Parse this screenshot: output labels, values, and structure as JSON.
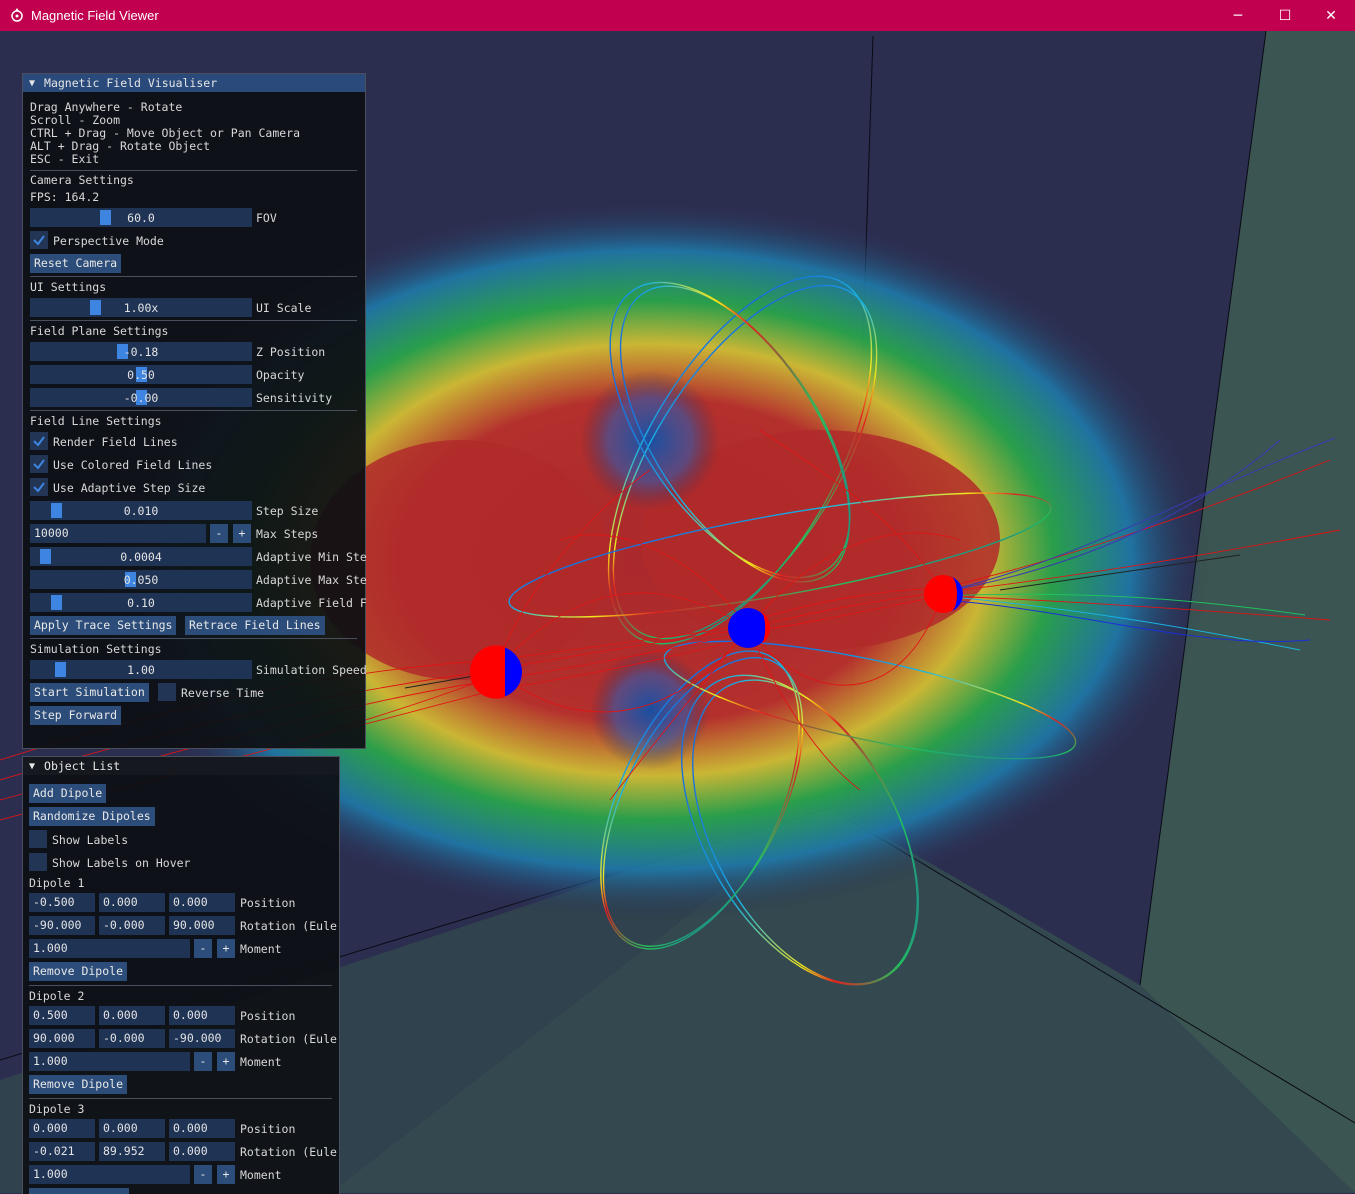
{
  "window": {
    "title": "Magnetic Field Viewer",
    "minimize": "─",
    "maximize": "☐",
    "close": "✕"
  },
  "visualiser": {
    "title": "Magnetic Field Visualiser",
    "help": [
      "Drag Anywhere - Rotate",
      "Scroll - Zoom",
      "CTRL + Drag - Move Object or Pan Camera",
      "ALT + Drag - Rotate Object",
      "ESC - Exit"
    ],
    "camera": {
      "heading": "Camera Settings",
      "fps": "FPS: 164.2",
      "fov_value": "60.0",
      "fov_label": "FOV",
      "fov_fraction": 0.33,
      "perspective_label": "Perspective Mode",
      "perspective_checked": true,
      "reset_label": "Reset Camera"
    },
    "ui": {
      "heading": "UI Settings",
      "scale_value": "1.00x",
      "scale_label": "UI Scale",
      "scale_fraction": 0.28
    },
    "plane": {
      "heading": "Field Plane Settings",
      "z_value": "-0.18",
      "z_label": "Z Position",
      "z_fraction": 0.41,
      "opacity_value": "0.50",
      "opacity_label": "Opacity",
      "opacity_fraction": 0.5,
      "sens_value": "-0.00",
      "sens_label": "Sensitivity",
      "sens_fraction": 0.5
    },
    "lines": {
      "heading": "Field Line Settings",
      "render_label": "Render Field Lines",
      "colored_label": "Use Colored Field Lines",
      "adaptive_label": "Use Adaptive Step Size",
      "step_value": "0.010",
      "step_label": "Step Size",
      "step_fraction": 0.09,
      "max_steps_value": "10000",
      "max_steps_label": "Max Steps",
      "minus": "-",
      "plus": "+",
      "amin_value": "0.0004",
      "amin_label": "Adaptive Min Ste",
      "amin_fraction": 0.04,
      "amax_value": "0.050",
      "amax_label": "Adaptive Max Ste",
      "amax_fraction": 0.45,
      "afield_value": "0.10",
      "afield_label": "Adaptive Field F",
      "afield_fraction": 0.09,
      "apply_label": "Apply Trace Settings",
      "retrace_label": "Retrace Field Lines"
    },
    "sim": {
      "heading": "Simulation Settings",
      "speed_value": "1.00",
      "speed_label": "Simulation Speed",
      "speed_fraction": 0.11,
      "start_label": "Start Simulation",
      "reverse_label": "Reverse Time",
      "step_label": "Step Forward"
    }
  },
  "objects": {
    "title": "Object List",
    "add_label": "Add Dipole",
    "randomize_label": "Randomize Dipoles",
    "show_labels": "Show Labels",
    "show_labels_hover": "Show Labels on Hover",
    "position_label": "Position",
    "rotation_label": "Rotation (Eule",
    "moment_label": "Moment",
    "remove_label": "Remove Dipole",
    "minus": "-",
    "plus": "+",
    "dipoles": [
      {
        "name": "Dipole 1",
        "pos": [
          "-0.500",
          "0.000",
          "0.000"
        ],
        "rot": [
          "-90.000",
          "-0.000",
          "90.000"
        ],
        "moment": "1.000"
      },
      {
        "name": "Dipole 2",
        "pos": [
          "0.500",
          "0.000",
          "0.000"
        ],
        "rot": [
          "90.000",
          "-0.000",
          "-90.000"
        ],
        "moment": "1.000"
      },
      {
        "name": "Dipole 3",
        "pos": [
          "0.000",
          "0.000",
          "0.000"
        ],
        "rot": [
          "-0.021",
          "89.952",
          "0.000"
        ],
        "moment": "1.000"
      }
    ]
  },
  "colors": {
    "titlebar": "#c1004f",
    "accent": "#3d85e0",
    "panel_header": "#294a7a",
    "frame": "#2c4d79"
  }
}
